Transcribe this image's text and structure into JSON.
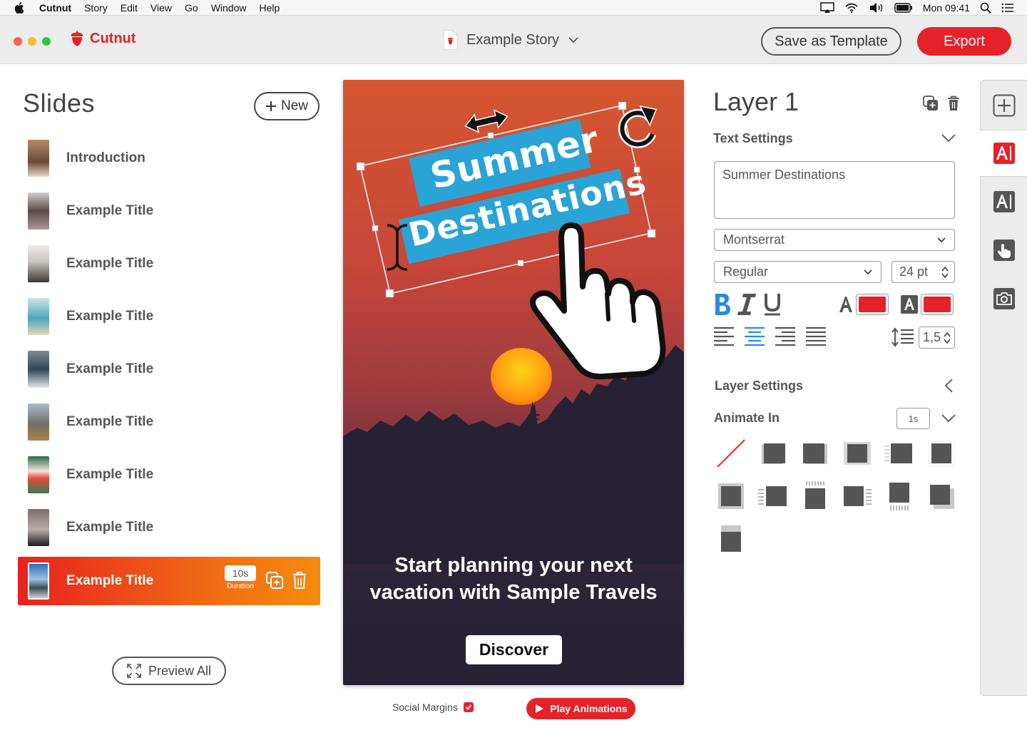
{
  "menubar": {
    "app_name": "Cutnut",
    "items": [
      "Story",
      "Edit",
      "View",
      "Go",
      "Window",
      "Help"
    ],
    "clock": "Mon 09:41"
  },
  "titlebar": {
    "brand": "Cutnut",
    "document_title": "Example Story",
    "save_template_label": "Save as Template",
    "export_label": "Export"
  },
  "slides": {
    "heading": "Slides",
    "new_label": "New",
    "items": [
      {
        "label": "Introduction",
        "thumb": "#8a6a52"
      },
      {
        "label": "Example Title",
        "thumb": "#6d5f63"
      },
      {
        "label": "Example Title",
        "thumb": "#7c7e80"
      },
      {
        "label": "Example Title",
        "thumb": "#5fa6b5"
      },
      {
        "label": "Example Title",
        "thumb": "#4e6172"
      },
      {
        "label": "Example Title",
        "thumb": "#86919c"
      },
      {
        "label": "Example Title",
        "thumb": "#3f7c5a"
      },
      {
        "label": "Example Title",
        "thumb": "#5c5854"
      }
    ],
    "active_item": {
      "label": "Example Title",
      "duration": "10s",
      "duration_caption": "Duration",
      "thumb": "#4b7fb8"
    },
    "preview_label": "Preview All"
  },
  "canvas": {
    "title_line1": "Summer",
    "title_line2": "Destinations",
    "tagline_line1": "Start planning your next",
    "tagline_line2": "vacation with Sample Travels",
    "cta_label": "Discover",
    "social_margins_label": "Social Margins",
    "social_margins_checked": true,
    "play_label": "Play Animations"
  },
  "properties": {
    "layer_title": "Layer 1",
    "text_settings_label": "Text Settings",
    "text_value": "Summer Destinations",
    "font_family": "Montserrat",
    "font_weight": "Regular",
    "font_size": "24 pt",
    "line_height": "1,5",
    "text_color": "#e5212a",
    "bg_color": "#e5212a",
    "layer_settings_label": "Layer Settings",
    "animate_in_label": "Animate In",
    "animate_duration": "1s"
  },
  "colors": {
    "accent": "#e5212a",
    "highlight": "#2aa3d6"
  }
}
